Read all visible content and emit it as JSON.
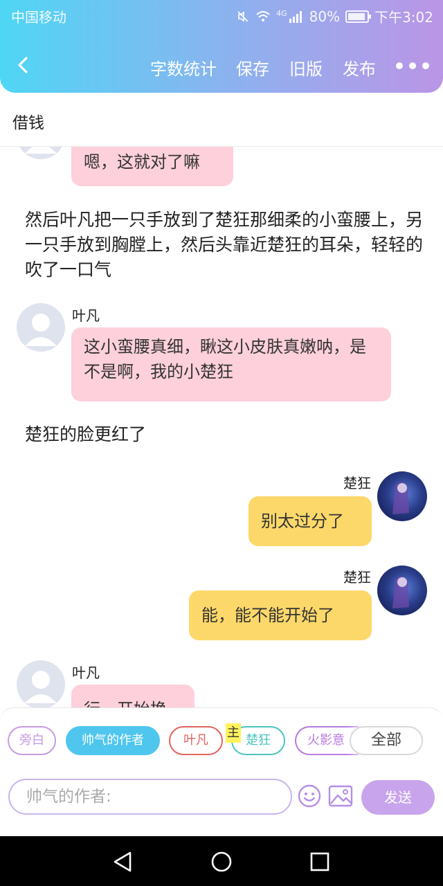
{
  "status_bar": {
    "carrier": "中国移动",
    "network": "4G",
    "battery": "80%",
    "time": "下午3:02"
  },
  "header": {
    "actions": [
      "字数统计",
      "保存",
      "旧版",
      "发布"
    ]
  },
  "title": "借钱",
  "chat": {
    "m1": {
      "text": "嗯，这就对了嘛"
    },
    "narr1": "然后叶凡把一只手放到了楚狂那细柔的小蛮腰上，另一只手放到胸膛上，然后头靠近楚狂的耳朵，轻轻的吹了一口气",
    "m2": {
      "sender": "叶凡",
      "text": "这小蛮腰真细，瞅这小皮肤真嫩呐，是不是啊，我的小楚狂"
    },
    "narr2": "楚狂的脸更红了",
    "m3": {
      "sender": "楚狂",
      "text": "别太过分了"
    },
    "m4": {
      "sender": "楚狂",
      "text": "能，能不能开始了"
    },
    "m5": {
      "sender": "叶凡",
      "text": "行，开始换"
    }
  },
  "role_chips": [
    "旁白",
    "帅气的作者",
    "叶凡",
    "楚狂",
    "火影意",
    "全部"
  ],
  "role_marker": "主",
  "chip_colors": {
    "旁白": "#c79be0",
    "帅气的作者": "#4fc6ee",
    "叶凡": "#e0645c",
    "楚狂": "#4cc4c0",
    "火影意": "#b77ae0",
    "全部": "#555555"
  },
  "input": {
    "placeholder": "帅气的作者:"
  },
  "send_label": "发送"
}
